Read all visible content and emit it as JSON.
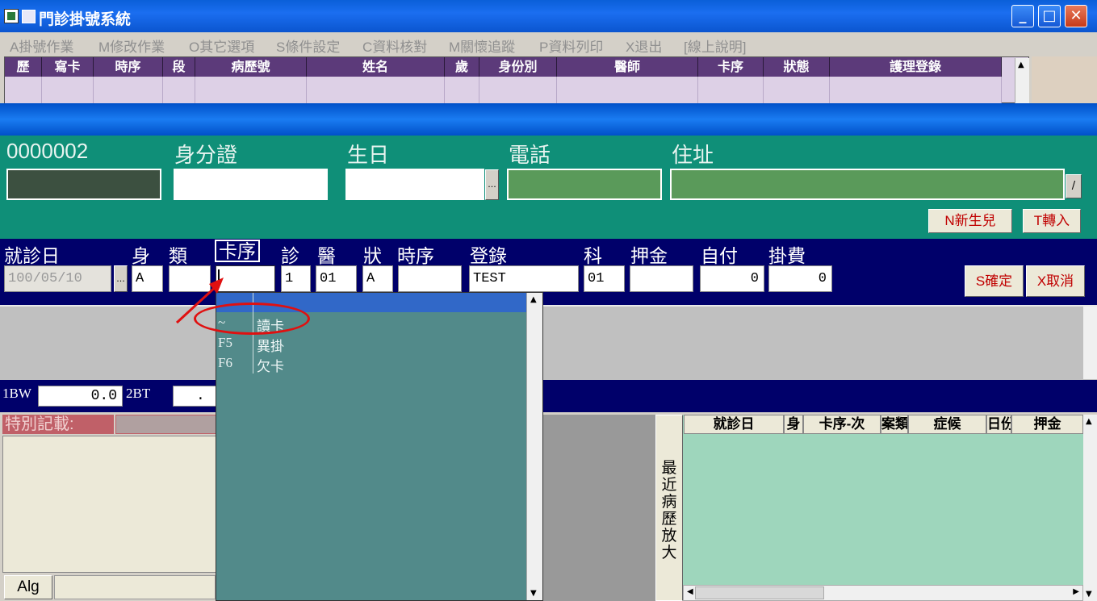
{
  "window": {
    "title": "門診掛號系統"
  },
  "menu": [
    "A掛號作業",
    "M修改作業",
    "O其它選項",
    "S條件設定",
    "C資料核對",
    "M關懷追蹤",
    "P資料列印",
    "X退出",
    "[線上說明]"
  ],
  "top_grid": {
    "columns": [
      "歷",
      "寫卡",
      "時序",
      "段",
      "病歷號",
      "姓名",
      "歲",
      "身份別",
      "醫師",
      "卡序",
      "狀態",
      "護理登錄"
    ]
  },
  "patient": {
    "chart_no": "0000002",
    "id_label": "身分證",
    "birthday_label": "生日",
    "phone_label": "電話",
    "address_label": "住址",
    "slash_btn": "/",
    "ellipsis_btn": "..."
  },
  "actions": {
    "newborn": "N新生兒",
    "transfer": "T轉入",
    "confirm": "S確定",
    "cancel": "X取消"
  },
  "registration": {
    "labels": {
      "date": "就診日",
      "identity": "身",
      "category": "類",
      "card_seq": "卡序",
      "clinic": "診",
      "doctor": "醫",
      "status": "狀",
      "time_seq": "時序",
      "login": "登錄",
      "dept": "科",
      "deposit": "押金",
      "self_pay": "自付",
      "fee": "掛費"
    },
    "values": {
      "date": "100/05/10",
      "identity": "A",
      "category": "",
      "card_seq": "",
      "clinic": "1",
      "doctor": "01",
      "status": "A",
      "time_seq": "",
      "login": "TEST",
      "dept": "01",
      "deposit": "",
      "self_pay": "0",
      "fee": "0"
    },
    "ellipsis_btn": "..."
  },
  "vitals": {
    "bw_label": "1BW",
    "bw_value": "0.0",
    "bt_label": "2BT",
    "bt_value": "."
  },
  "special": {
    "label": "特別記載:"
  },
  "alg": {
    "label": "Alg"
  },
  "zoom_button": "最近病歷放大",
  "history": {
    "columns": [
      "就診日",
      "身",
      "卡序-次",
      "案類",
      "症候",
      "日份",
      "押金"
    ]
  },
  "dropdown": {
    "items": [
      {
        "key": "",
        "value": ""
      },
      {
        "key": "~",
        "value": "讀卡"
      },
      {
        "key": "F5",
        "value": "異掛"
      },
      {
        "key": "F6",
        "value": "欠卡"
      }
    ]
  },
  "colors": {
    "title_blue": "#0a5fd8",
    "grid_header": "#5c3a7a",
    "info_teal": "#0f8f78",
    "reg_navy": "#00006a",
    "dropdown_teal": "#528a8a",
    "history_mint": "#9ed6bc",
    "annotation_red": "#e01010"
  }
}
